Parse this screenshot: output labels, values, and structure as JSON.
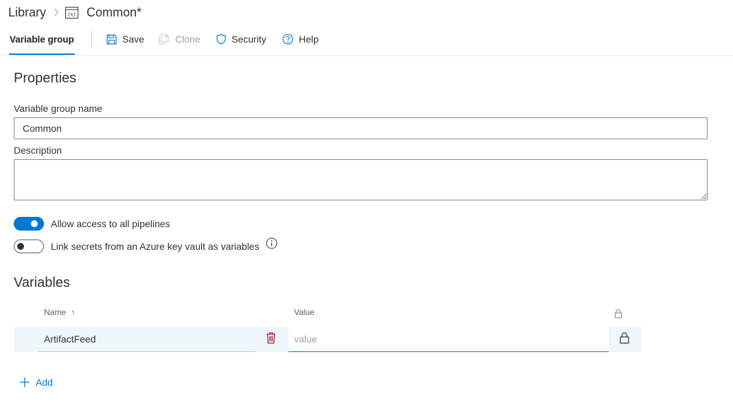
{
  "breadcrumb": {
    "root": "Library",
    "current": "Common*",
    "current_icon": "variable-group-icon"
  },
  "toolbar": {
    "tab_label": "Variable group",
    "save_label": "Save",
    "clone_label": "Clone",
    "security_label": "Security",
    "help_label": "Help",
    "icons": [
      "save-icon",
      "clone-icon",
      "shield-icon",
      "help-icon"
    ]
  },
  "properties": {
    "title": "Properties",
    "name_label": "Variable group name",
    "name_value": "Common",
    "description_label": "Description",
    "description_value": ""
  },
  "toggles": {
    "allow_access": {
      "label": "Allow access to all pipelines",
      "on": true
    },
    "link_secrets": {
      "label": "Link secrets from an Azure key vault as variables",
      "on": false
    }
  },
  "variables": {
    "title": "Variables",
    "columns": {
      "name": "Name",
      "value": "Value"
    },
    "sort_indicator": "↑",
    "rows": [
      {
        "name": "ArtifactFeed",
        "value": "",
        "value_placeholder": "value",
        "secret": false
      }
    ],
    "add_label": "Add"
  },
  "colors": {
    "accent": "#0078d4",
    "row_highlight": "#eff6fc",
    "delete_icon": "#a4262c",
    "text": "#323130"
  }
}
